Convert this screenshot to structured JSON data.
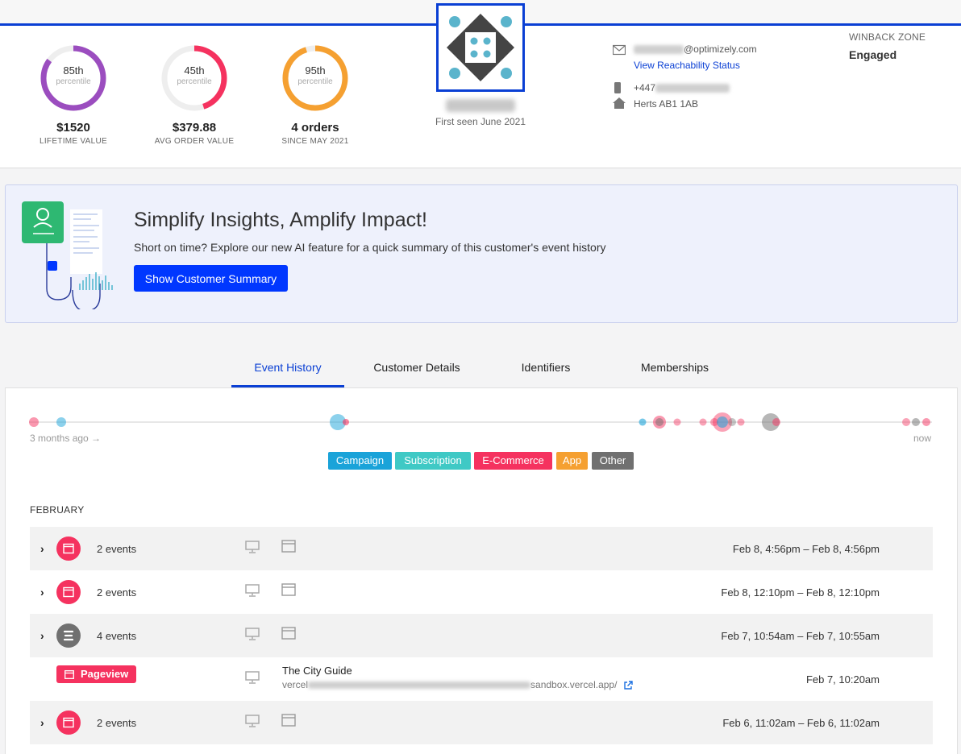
{
  "metrics": [
    {
      "percentile": "85th",
      "sub": "percentile",
      "value": "$1520",
      "label": "LIFETIME VALUE",
      "color": "#9b4dbf",
      "fraction": 0.85
    },
    {
      "percentile": "45th",
      "sub": "percentile",
      "value": "$379.88",
      "label": "AVG ORDER VALUE",
      "color": "#f5325f",
      "fraction": 0.45
    },
    {
      "percentile": "95th",
      "sub": "percentile",
      "value": "4 orders",
      "label": "SINCE MAY 2021",
      "color": "#f5a031",
      "fraction": 0.95
    }
  ],
  "profile": {
    "first_seen": "First seen June 2021"
  },
  "contact": {
    "email_domain": "@optimizely.com",
    "reachability_link": "View Reachability Status",
    "phone_prefix": "+447",
    "address": "Herts AB1 1AB"
  },
  "winback": {
    "label": "WINBACK ZONE",
    "value": "Engaged"
  },
  "promo": {
    "title": "Simplify Insights, Amplify Impact!",
    "text": "Short on time? Explore our new AI feature for a quick summary of this customer's event history",
    "button": "Show Customer Summary"
  },
  "tabs": [
    "Event History",
    "Customer Details",
    "Identifiers",
    "Memberships"
  ],
  "timeline": {
    "start_label": "3 months ago →",
    "end_label": "now"
  },
  "legend": [
    {
      "label": "Campaign",
      "color": "#1aa3d9"
    },
    {
      "label": "Subscription",
      "color": "#3fc9c5"
    },
    {
      "label": "E-Commerce",
      "color": "#f5325f"
    },
    {
      "label": "App",
      "color": "#f5a031"
    },
    {
      "label": "Other",
      "color": "#707070"
    }
  ],
  "month_label": "FEBRUARY",
  "events": [
    {
      "count": "2 events",
      "time": "Feb 8, 4:56pm – Feb 8, 4:56pm",
      "icon": "browser-icon",
      "color": "#f5325f"
    },
    {
      "count": "2 events",
      "time": "Feb 8, 12:10pm – Feb 8, 12:10pm",
      "icon": "browser-icon",
      "color": "#f5325f"
    },
    {
      "count": "4 events",
      "time": "Feb 7, 10:54am – Feb 7, 10:55am",
      "icon": "list-icon",
      "color": "#707070"
    },
    {
      "count": "2 events",
      "time": "Feb 6, 11:02am – Feb 6, 11:02am",
      "icon": "browser-icon",
      "color": "#f5325f"
    }
  ],
  "pageview": {
    "badge": "Pageview",
    "title": "The City Guide",
    "url_prefix": "vercel",
    "url_suffix": "sandbox.vercel.app/",
    "time": "Feb 7, 10:20am"
  }
}
